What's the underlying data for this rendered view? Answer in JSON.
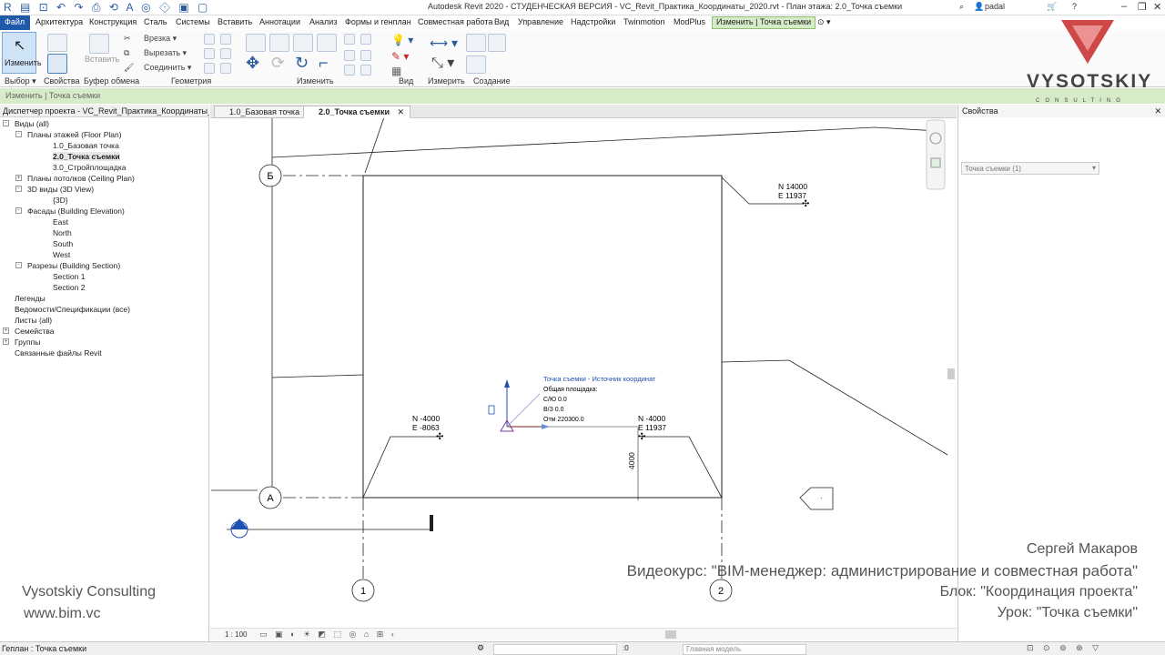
{
  "titlebar": {
    "title": "Autodesk Revit 2020 - СТУДЕНЧЕСКАЯ ВЕРСИЯ - VC_Revit_Практика_Координаты_2020.rvt - План этажа: 2.0_Точка съемки",
    "user": "padal"
  },
  "menu": {
    "file": "Файл",
    "items": [
      "Архитектура",
      "Конструкция",
      "Сталь",
      "Системы",
      "Вставить",
      "Аннотации",
      "Анализ",
      "Формы и генплан",
      "Совместная работа",
      "Вид",
      "Управление",
      "Надстройки",
      "Twinmotion",
      "ModPlus"
    ],
    "active": "Изменить | Точка съемки"
  },
  "ribbon": {
    "modify_label": "Изменить",
    "paste_label": "Вставить",
    "cut_label": "Врезка",
    "cutout_label": "Вырезать",
    "join_label": "Соединить",
    "panels": [
      "Выбор",
      "Свойства",
      "Буфер обмена",
      "Геометрия",
      "Изменить",
      "Вид",
      "Измерить",
      "Создание"
    ]
  },
  "context_bar": {
    "text": "Изменить | Точка съемки"
  },
  "browser": {
    "header": "Диспетчер проекта - VC_Revit_Практика_Координаты_2020.rvt",
    "items": [
      {
        "label": "Виды (all)",
        "level": 0,
        "toggle": "-"
      },
      {
        "label": "Планы этажей (Floor Plan)",
        "level": 1,
        "toggle": "-"
      },
      {
        "label": "1.0_Базовая точка",
        "level": 2
      },
      {
        "label": "2.0_Точка съемки",
        "level": 2,
        "selected": true
      },
      {
        "label": "3.0_Стройплощадка",
        "level": 2
      },
      {
        "label": "Планы потолков (Ceiling Plan)",
        "level": 1,
        "toggle": "+"
      },
      {
        "label": "3D виды (3D View)",
        "level": 1,
        "toggle": "-"
      },
      {
        "label": "{3D}",
        "level": 2
      },
      {
        "label": "Фасады (Building Elevation)",
        "level": 1,
        "toggle": "-"
      },
      {
        "label": "East",
        "level": 2
      },
      {
        "label": "North",
        "level": 2
      },
      {
        "label": "South",
        "level": 2
      },
      {
        "label": "West",
        "level": 2
      },
      {
        "label": "Разрезы (Building Section)",
        "level": 1,
        "toggle": "-"
      },
      {
        "label": "Section 1",
        "level": 2
      },
      {
        "label": "Section 2",
        "level": 2
      },
      {
        "label": "Легенды",
        "level": 0
      },
      {
        "label": "Ведомости/Спецификации (все)",
        "level": 0
      },
      {
        "label": "Листы (all)",
        "level": 0
      },
      {
        "label": "Семейства",
        "level": 0,
        "toggle": "+"
      },
      {
        "label": "Группы",
        "level": 0,
        "toggle": "+"
      },
      {
        "label": "Связанные файлы Revit",
        "level": 0
      }
    ]
  },
  "tabs": [
    {
      "label": "1.0_Базовая точка",
      "active": false
    },
    {
      "label": "2.0_Точка съемки",
      "active": true,
      "close": "✕"
    }
  ],
  "canvas": {
    "grid_b": "Б",
    "grid_a": "А",
    "grid_1": "1",
    "grid_2": "2",
    "tag_ne_n": "N 14000",
    "tag_ne_e": "E 11937",
    "tag_sw_n": "N -4000",
    "tag_sw_e": "E -8063",
    "tag_se_n": "N -4000",
    "tag_se_e": "E 11937",
    "dim_4000": "4000",
    "survey_title": "Точка съемки - Источник координат",
    "survey_site": "Общая площадка:",
    "survey_ns": "С/Ю   0.0",
    "survey_ew": "В/З   0.0",
    "survey_elev": "Отм   220300.0"
  },
  "viewbar": {
    "scale": "1 : 100"
  },
  "properties": {
    "header": "Свойства",
    "selector": "Точка съемки (1)"
  },
  "statusbar": {
    "text": "Геплан : Точка съемки",
    "zero": ":0",
    "model": "Главная модель"
  },
  "branding": {
    "brand": "VYSOTSKIY",
    "sub": "CONSULTING",
    "left_name": "Vysotskiy Consulting",
    "left_url": "www.bim.vc",
    "author": "Сергей Макаров",
    "course": "Видеокурс: \"BIM-менеджер: администрирование и совместная работа\"",
    "block": "Блок: \"Координация проекта\"",
    "lesson": "Урок: \"Точка съемки\""
  },
  "colors": {
    "file_menu": "#1e5aa8",
    "context_green": "#d6ebc8",
    "logo_red": "#c62828",
    "survey_blue": "#1f4fb0"
  }
}
